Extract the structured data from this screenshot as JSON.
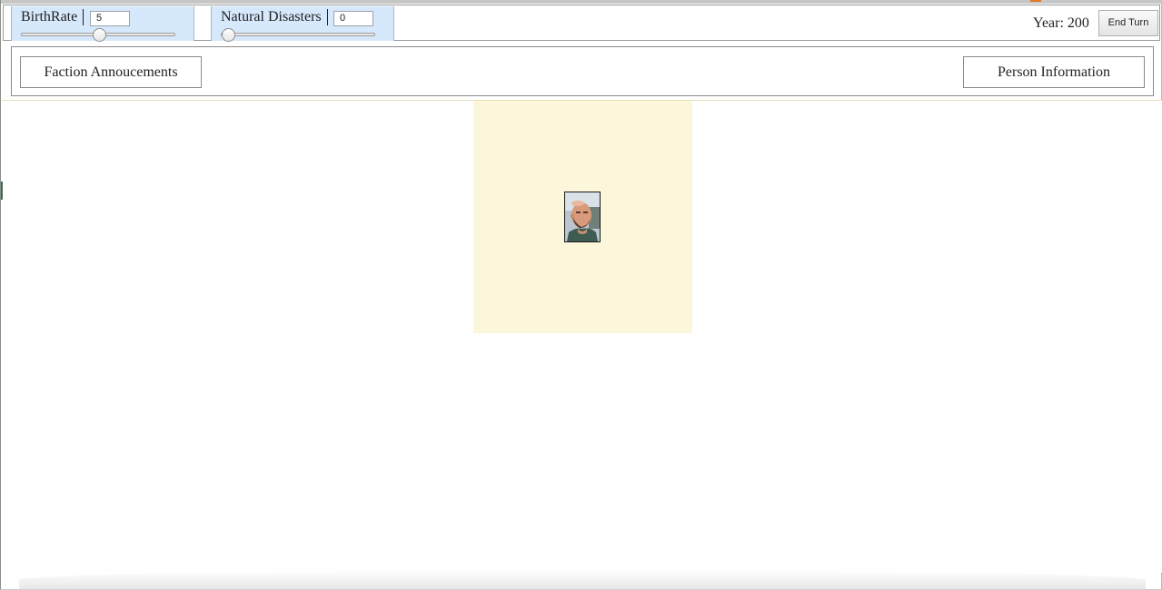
{
  "controls": {
    "birthrate": {
      "label": "BirthRate",
      "value": "5",
      "slider_fraction": 0.5
    },
    "disasters": {
      "label": "Natural Disasters",
      "value": "0",
      "slider_fraction": 0.0
    },
    "year_text": "Year: 200",
    "end_turn_label": "End Turn"
  },
  "panels": {
    "faction_label": "Faction Annoucements",
    "person_label": "Person Information"
  },
  "colors": {
    "slider_panel_bg": "#d6e8fb",
    "faction_tile_bg": "#fcf6da",
    "page_bg": "#ffffff"
  },
  "icons": {
    "portrait": "bald-man-portrait"
  }
}
